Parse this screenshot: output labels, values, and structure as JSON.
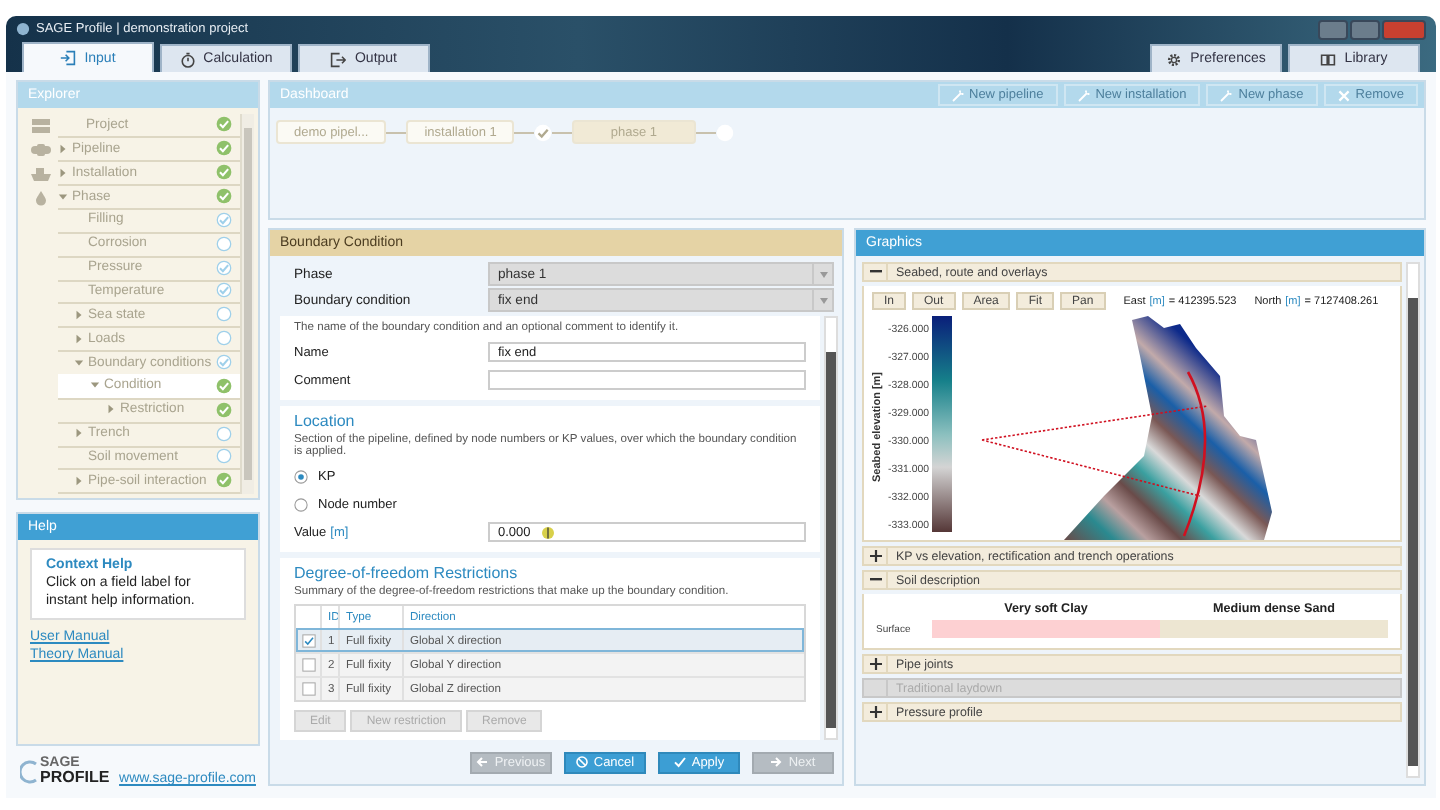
{
  "window": {
    "title": "SAGE Profile | demonstration project"
  },
  "tabs": [
    {
      "label": "Input",
      "selected": true
    },
    {
      "label": "Calculation",
      "selected": false
    },
    {
      "label": "Output",
      "selected": false
    }
  ],
  "right_tabs": [
    {
      "label": "Preferences"
    },
    {
      "label": "Library"
    }
  ],
  "explorer": {
    "title": "Explorer",
    "items": [
      {
        "label": "Project",
        "kind": "leaf",
        "complete": true,
        "checked": true,
        "selected": false
      },
      {
        "label": "Pipeline",
        "kind": "group",
        "expanded": false,
        "complete": true,
        "checked": true,
        "selected": false
      },
      {
        "label": "Installation",
        "kind": "group",
        "expanded": false,
        "complete": true,
        "checked": true,
        "selected": false
      },
      {
        "label": "Phase",
        "kind": "group",
        "expanded": true,
        "complete": true,
        "checked": true,
        "selected": false,
        "children": [
          {
            "label": "Filling",
            "kind": "leaf",
            "complete": false,
            "checked": true,
            "selected": false
          },
          {
            "label": "Corrosion",
            "kind": "leaf",
            "complete": false,
            "checked": false,
            "selected": false
          },
          {
            "label": "Pressure",
            "kind": "leaf",
            "complete": false,
            "checked": true,
            "selected": false
          },
          {
            "label": "Temperature",
            "kind": "leaf",
            "complete": false,
            "checked": true,
            "selected": false
          },
          {
            "label": "Sea state",
            "kind": "group",
            "expanded": false,
            "complete": false,
            "checked": false,
            "selected": false
          },
          {
            "label": "Loads",
            "kind": "group",
            "expanded": false,
            "complete": false,
            "checked": false,
            "selected": false
          },
          {
            "label": "Boundary conditions",
            "kind": "group",
            "expanded": true,
            "complete": false,
            "checked": true,
            "selected": false,
            "children": [
              {
                "label": "Condition",
                "kind": "group",
                "expanded": true,
                "complete": true,
                "checked": true,
                "selected": true,
                "children": [
                  {
                    "label": "Restriction",
                    "kind": "group",
                    "expanded": false,
                    "complete": true,
                    "checked": true,
                    "selected": false
                  }
                ]
              }
            ]
          },
          {
            "label": "Trench",
            "kind": "group",
            "expanded": false,
            "complete": false,
            "checked": false,
            "selected": false
          },
          {
            "label": "Soil movement",
            "kind": "leaf",
            "complete": false,
            "checked": false,
            "selected": false
          },
          {
            "label": "Pipe-soil interaction",
            "kind": "group",
            "expanded": false,
            "complete": true,
            "checked": true,
            "selected": false
          }
        ]
      }
    ]
  },
  "help": {
    "title": "Help",
    "context_title": "Context Help",
    "context_text": "Click on a field label for instant help information.",
    "links": [
      "User Manual",
      "Theory Manual"
    ],
    "logo_top": "SAGE",
    "logo_bottom": "PROFILE",
    "website": "www.sage-profile.com"
  },
  "dashboard": {
    "title": "Dashboard",
    "actions": [
      {
        "label": "New pipeline",
        "kind": "new",
        "disabled": true
      },
      {
        "label": "New installation",
        "kind": "new",
        "disabled": true
      },
      {
        "label": "New phase",
        "kind": "new",
        "disabled": true
      },
      {
        "label": "Remove",
        "kind": "remove",
        "disabled": true
      }
    ],
    "flow": [
      {
        "kind": "node",
        "label": "demo pipel...",
        "selected": false
      },
      {
        "kind": "node",
        "label": "installation 1",
        "selected": false
      },
      {
        "kind": "done"
      },
      {
        "kind": "node",
        "label": "phase 1",
        "selected": true
      },
      {
        "kind": "open"
      }
    ]
  },
  "boundary_condition": {
    "title": "Boundary Condition",
    "selectors": [
      {
        "label": "Phase",
        "value": "phase 1"
      },
      {
        "label": "Boundary condition",
        "value": "fix end"
      }
    ],
    "identity": {
      "description": "The name of the boundary condition and an optional comment to identify it.",
      "fields": [
        {
          "label": "Name",
          "value": "fix end"
        },
        {
          "label": "Comment"
        }
      ]
    },
    "location": {
      "title": "Location",
      "description": "Section of the pipeline, defined by node numbers or KP values, over which the boundary condition is applied.",
      "options": [
        {
          "label": "KP",
          "selected": true
        },
        {
          "label": "Node number",
          "selected": false
        }
      ],
      "value_label": "Value",
      "value_unit": "[m]",
      "value": "0.000"
    },
    "restrictions": {
      "title": "Degree-of-freedom Restrictions",
      "description": "Summary of the degree-of-freedom restrictions that make up the boundary condition.",
      "columns": [
        "ID",
        "Type",
        "Direction"
      ],
      "rows": [
        {
          "id": "1",
          "type": "Full fixity",
          "direction": "Global X direction",
          "checked": true,
          "selected": true
        },
        {
          "id": "2",
          "type": "Full fixity",
          "direction": "Global Y direction",
          "checked": false,
          "selected": false
        },
        {
          "id": "3",
          "type": "Full fixity",
          "direction": "Global Z direction",
          "checked": false,
          "selected": false
        }
      ],
      "buttons": [
        {
          "label": "Edit",
          "disabled": true
        },
        {
          "label": "New restriction",
          "disabled": true
        },
        {
          "label": "Remove",
          "disabled": true
        }
      ]
    },
    "footer": [
      {
        "label": "Previous",
        "kind": "previous",
        "disabled": true
      },
      {
        "label": "Cancel",
        "kind": "cancel",
        "disabled": false
      },
      {
        "label": "Apply",
        "kind": "apply",
        "disabled": false
      },
      {
        "label": "Next",
        "kind": "next",
        "disabled": true
      }
    ]
  },
  "graphics": {
    "title": "Graphics",
    "sections": [
      {
        "title": "Seabed, route and overlays",
        "kind": "map",
        "expanded": true,
        "disabled": false,
        "tools": [
          "In",
          "Out",
          "Area",
          "Fit",
          "Pan"
        ],
        "coordinates": [
          {
            "label": "East",
            "unit": "[m]",
            "value": "= 412395.523"
          },
          {
            "label": "North",
            "unit": "[m]",
            "value": "= 7127408.261"
          }
        ],
        "scale_title": "Seabed elevation [m]",
        "scale_ticks": [
          "-326.000",
          "-327.000",
          "-328.000",
          "-329.000",
          "-330.000",
          "-331.000",
          "-332.000",
          "-333.000"
        ]
      },
      {
        "title": "KP vs elevation, rectification and trench operations",
        "expanded": false,
        "disabled": false
      },
      {
        "title": "Soil description",
        "kind": "soil",
        "expanded": true,
        "disabled": false,
        "row_label": "Surface",
        "layers": [
          {
            "name": "Very soft Clay",
            "color": "#fdd0d2"
          },
          {
            "name": "Medium dense Sand",
            "color": "#ede6d2"
          }
        ]
      },
      {
        "title": "Pipe joints",
        "expanded": false,
        "disabled": false
      },
      {
        "title": "Traditional laydown",
        "expanded": false,
        "disabled": true
      },
      {
        "title": "Pressure profile",
        "expanded": false,
        "disabled": false
      }
    ]
  }
}
